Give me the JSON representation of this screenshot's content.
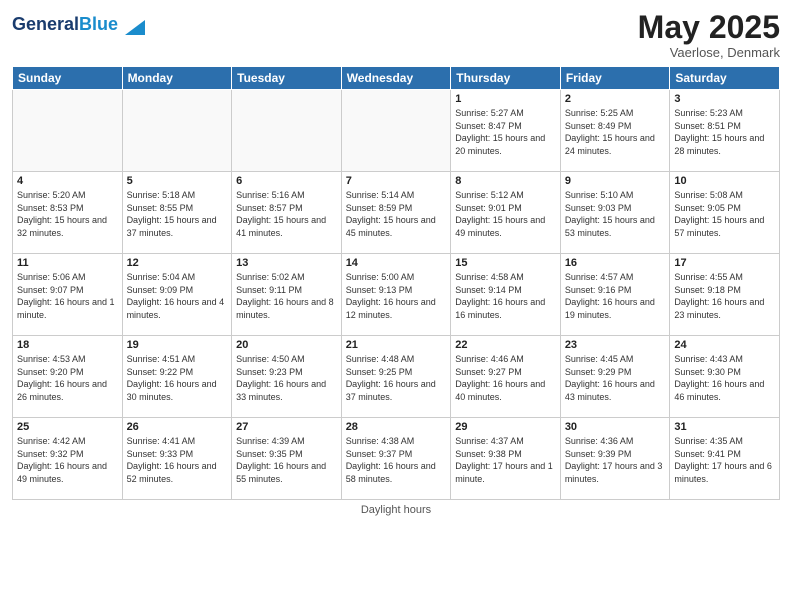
{
  "header": {
    "logo_line1": "General",
    "logo_line2": "Blue",
    "month": "May 2025",
    "location": "Vaerlose, Denmark"
  },
  "days_of_week": [
    "Sunday",
    "Monday",
    "Tuesday",
    "Wednesday",
    "Thursday",
    "Friday",
    "Saturday"
  ],
  "weeks": [
    [
      {
        "day": "",
        "info": ""
      },
      {
        "day": "",
        "info": ""
      },
      {
        "day": "",
        "info": ""
      },
      {
        "day": "",
        "info": ""
      },
      {
        "day": "1",
        "info": "Sunrise: 5:27 AM\nSunset: 8:47 PM\nDaylight: 15 hours\nand 20 minutes."
      },
      {
        "day": "2",
        "info": "Sunrise: 5:25 AM\nSunset: 8:49 PM\nDaylight: 15 hours\nand 24 minutes."
      },
      {
        "day": "3",
        "info": "Sunrise: 5:23 AM\nSunset: 8:51 PM\nDaylight: 15 hours\nand 28 minutes."
      }
    ],
    [
      {
        "day": "4",
        "info": "Sunrise: 5:20 AM\nSunset: 8:53 PM\nDaylight: 15 hours\nand 32 minutes."
      },
      {
        "day": "5",
        "info": "Sunrise: 5:18 AM\nSunset: 8:55 PM\nDaylight: 15 hours\nand 37 minutes."
      },
      {
        "day": "6",
        "info": "Sunrise: 5:16 AM\nSunset: 8:57 PM\nDaylight: 15 hours\nand 41 minutes."
      },
      {
        "day": "7",
        "info": "Sunrise: 5:14 AM\nSunset: 8:59 PM\nDaylight: 15 hours\nand 45 minutes."
      },
      {
        "day": "8",
        "info": "Sunrise: 5:12 AM\nSunset: 9:01 PM\nDaylight: 15 hours\nand 49 minutes."
      },
      {
        "day": "9",
        "info": "Sunrise: 5:10 AM\nSunset: 9:03 PM\nDaylight: 15 hours\nand 53 minutes."
      },
      {
        "day": "10",
        "info": "Sunrise: 5:08 AM\nSunset: 9:05 PM\nDaylight: 15 hours\nand 57 minutes."
      }
    ],
    [
      {
        "day": "11",
        "info": "Sunrise: 5:06 AM\nSunset: 9:07 PM\nDaylight: 16 hours\nand 1 minute."
      },
      {
        "day": "12",
        "info": "Sunrise: 5:04 AM\nSunset: 9:09 PM\nDaylight: 16 hours\nand 4 minutes."
      },
      {
        "day": "13",
        "info": "Sunrise: 5:02 AM\nSunset: 9:11 PM\nDaylight: 16 hours\nand 8 minutes."
      },
      {
        "day": "14",
        "info": "Sunrise: 5:00 AM\nSunset: 9:13 PM\nDaylight: 16 hours\nand 12 minutes."
      },
      {
        "day": "15",
        "info": "Sunrise: 4:58 AM\nSunset: 9:14 PM\nDaylight: 16 hours\nand 16 minutes."
      },
      {
        "day": "16",
        "info": "Sunrise: 4:57 AM\nSunset: 9:16 PM\nDaylight: 16 hours\nand 19 minutes."
      },
      {
        "day": "17",
        "info": "Sunrise: 4:55 AM\nSunset: 9:18 PM\nDaylight: 16 hours\nand 23 minutes."
      }
    ],
    [
      {
        "day": "18",
        "info": "Sunrise: 4:53 AM\nSunset: 9:20 PM\nDaylight: 16 hours\nand 26 minutes."
      },
      {
        "day": "19",
        "info": "Sunrise: 4:51 AM\nSunset: 9:22 PM\nDaylight: 16 hours\nand 30 minutes."
      },
      {
        "day": "20",
        "info": "Sunrise: 4:50 AM\nSunset: 9:23 PM\nDaylight: 16 hours\nand 33 minutes."
      },
      {
        "day": "21",
        "info": "Sunrise: 4:48 AM\nSunset: 9:25 PM\nDaylight: 16 hours\nand 37 minutes."
      },
      {
        "day": "22",
        "info": "Sunrise: 4:46 AM\nSunset: 9:27 PM\nDaylight: 16 hours\nand 40 minutes."
      },
      {
        "day": "23",
        "info": "Sunrise: 4:45 AM\nSunset: 9:29 PM\nDaylight: 16 hours\nand 43 minutes."
      },
      {
        "day": "24",
        "info": "Sunrise: 4:43 AM\nSunset: 9:30 PM\nDaylight: 16 hours\nand 46 minutes."
      }
    ],
    [
      {
        "day": "25",
        "info": "Sunrise: 4:42 AM\nSunset: 9:32 PM\nDaylight: 16 hours\nand 49 minutes."
      },
      {
        "day": "26",
        "info": "Sunrise: 4:41 AM\nSunset: 9:33 PM\nDaylight: 16 hours\nand 52 minutes."
      },
      {
        "day": "27",
        "info": "Sunrise: 4:39 AM\nSunset: 9:35 PM\nDaylight: 16 hours\nand 55 minutes."
      },
      {
        "day": "28",
        "info": "Sunrise: 4:38 AM\nSunset: 9:37 PM\nDaylight: 16 hours\nand 58 minutes."
      },
      {
        "day": "29",
        "info": "Sunrise: 4:37 AM\nSunset: 9:38 PM\nDaylight: 17 hours\nand 1 minute."
      },
      {
        "day": "30",
        "info": "Sunrise: 4:36 AM\nSunset: 9:39 PM\nDaylight: 17 hours\nand 3 minutes."
      },
      {
        "day": "31",
        "info": "Sunrise: 4:35 AM\nSunset: 9:41 PM\nDaylight: 17 hours\nand 6 minutes."
      }
    ]
  ],
  "footer": {
    "label": "Daylight hours"
  }
}
